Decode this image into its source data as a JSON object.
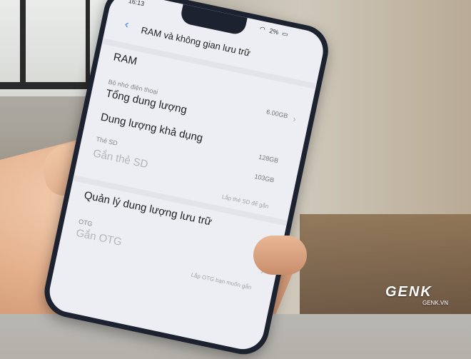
{
  "status_bar": {
    "time": "16:13",
    "battery": "2%"
  },
  "header": {
    "title": "RAM và không gian lưu trữ"
  },
  "rows": {
    "ram_label": "RAM",
    "phone_memory_section": "Bộ nhớ điện thoại",
    "ram_value": "6.00GB",
    "total_capacity_label": "Tổng dung lượng",
    "total_capacity_value": "128GB",
    "available_capacity_label": "Dung lượng khả dụng",
    "available_capacity_value": "103GB",
    "sd_section": "Thẻ SD",
    "mount_sd_label": "Gắn thẻ SD",
    "mount_sd_hint": "Lắp thẻ SD để gắn",
    "manage_storage_label": "Quản lý dung lượng lưu trữ",
    "otg_section": "OTG",
    "mount_otg_label": "Gắn OTG",
    "mount_otg_hint": "Lắp OTG bạn muốn gắn"
  },
  "watermark": {
    "logo": "GENK",
    "site": "GENK.VN"
  },
  "icons": [
    "back-arrow-icon",
    "wifi-icon",
    "battery-icon",
    "chevron-right-icon"
  ]
}
